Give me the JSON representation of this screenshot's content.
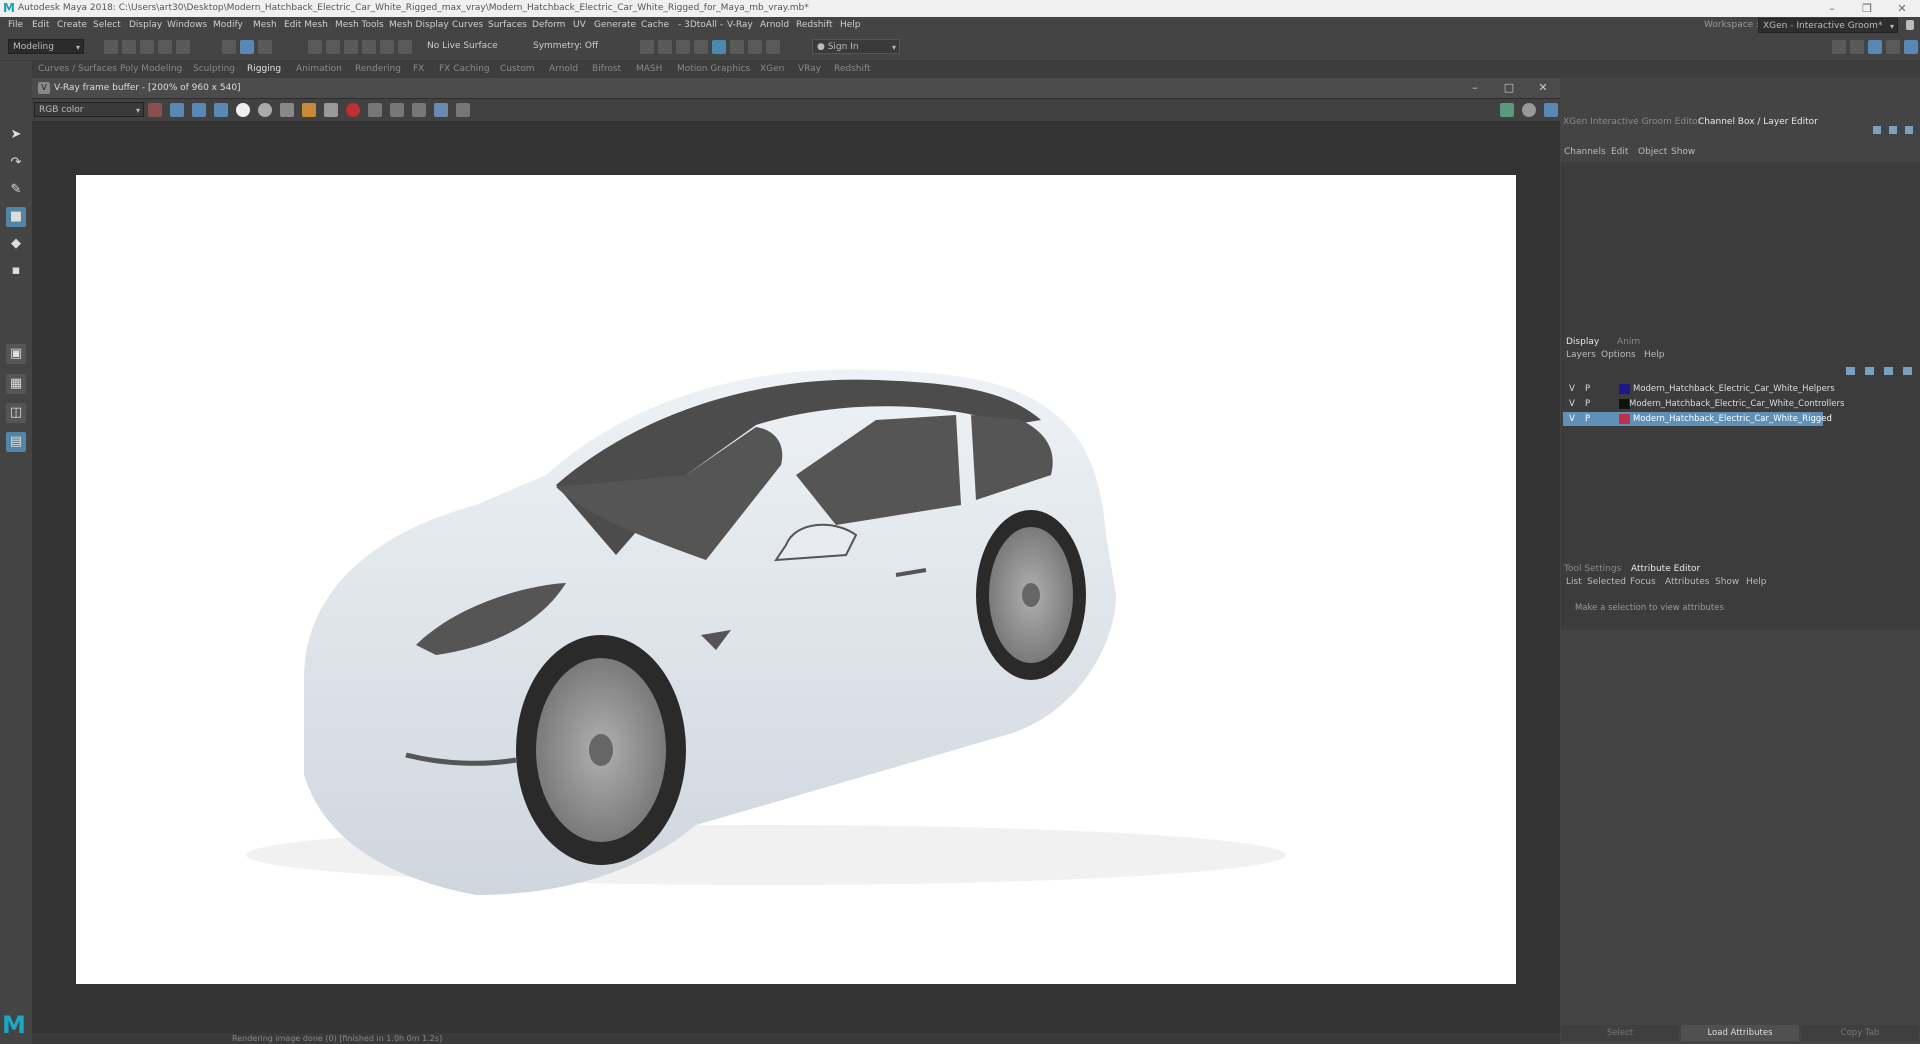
{
  "titlebar": {
    "logo": "M",
    "title": "Autodesk Maya 2018: C:\\Users\\art30\\Desktop\\Modern_Hatchback_Electric_Car_White_Rigged_max_vray\\Modern_Hatchback_Electric_Car_White_Rigged_for_Maya_mb_vray.mb*",
    "minimize": "–",
    "restore": "❐",
    "close": "✕"
  },
  "menubar": {
    "items": [
      "File",
      "Edit",
      "Create",
      "Select",
      "Display",
      "Windows",
      "Modify",
      "Mesh",
      "Edit Mesh",
      "Mesh Tools",
      "Mesh Display",
      "Curves",
      "Surfaces",
      "Deform",
      "UV",
      "Generate",
      "Cache",
      "- 3DtoAll -",
      "V-Ray",
      "Arnold",
      "Redshift",
      "Help"
    ],
    "workspace_label": "Workspace :",
    "workspace_value": "XGen - Interactive Groom*"
  },
  "statusline": {
    "mode": "Modeling",
    "live_surface": "No Live Surface",
    "symmetry": "Symmetry: Off",
    "sign_in": "Sign In"
  },
  "shelf": {
    "tabs": [
      "Curves / Surfaces",
      "Poly Modeling",
      "Sculpting",
      "Rigging",
      "Animation",
      "Rendering",
      "FX",
      "FX Caching",
      "Custom",
      "Arnold",
      "Bifrost",
      "MASH",
      "Motion Graphics",
      "XGen",
      "VRay",
      "Redshift"
    ],
    "active": "Rigging"
  },
  "vfb": {
    "title": "V-Ray frame buffer - [200% of 960 x 540]",
    "channel": "RGB color",
    "status": "Rendering image done (0) [finished in 1.0h 0m 1.2s]",
    "colors": {
      "button_blue": "#5a88b5",
      "record_red": "#c03030"
    }
  },
  "render": {
    "description_colors": {
      "body": "#dde3ea",
      "glass": "#4a4a4a",
      "rim": "#9a9a9a",
      "tire": "#2a2a2a"
    }
  },
  "rightpanel": {
    "top_tabs": [
      "XGen Interactive Groom Editor",
      "Channel Box / Layer Editor"
    ],
    "channel_menu": [
      "Channels",
      "Edit",
      "Object",
      "Show"
    ],
    "layer_tabs": [
      "Display",
      "Anim"
    ],
    "layer_menu": [
      "Layers",
      "Options",
      "Help"
    ],
    "layers": [
      {
        "v": "V",
        "p": "P",
        "name": "Modern_Hatchback_Electric_Car_White_Helpers",
        "color": "#1a1a8c",
        "selected": false
      },
      {
        "v": "V",
        "p": "P",
        "name": "Modern_Hatchback_Electric_Car_White_Controllers",
        "color": "#111111",
        "selected": false
      },
      {
        "v": "V",
        "p": "P",
        "name": "Modern_Hatchback_Electric_Car_White_Rigged",
        "color": "#c0304a",
        "selected": true
      }
    ],
    "attr_tabs": [
      "Tool Settings",
      "Attribute Editor"
    ],
    "attr_menu": [
      "List",
      "Selected",
      "Focus",
      "Attributes",
      "Show",
      "Help"
    ],
    "attr_message": "Make a selection to view attributes",
    "bottom_buttons": [
      "Select",
      "Load Attributes",
      "Copy Tab"
    ]
  },
  "bottom_logo": "M"
}
